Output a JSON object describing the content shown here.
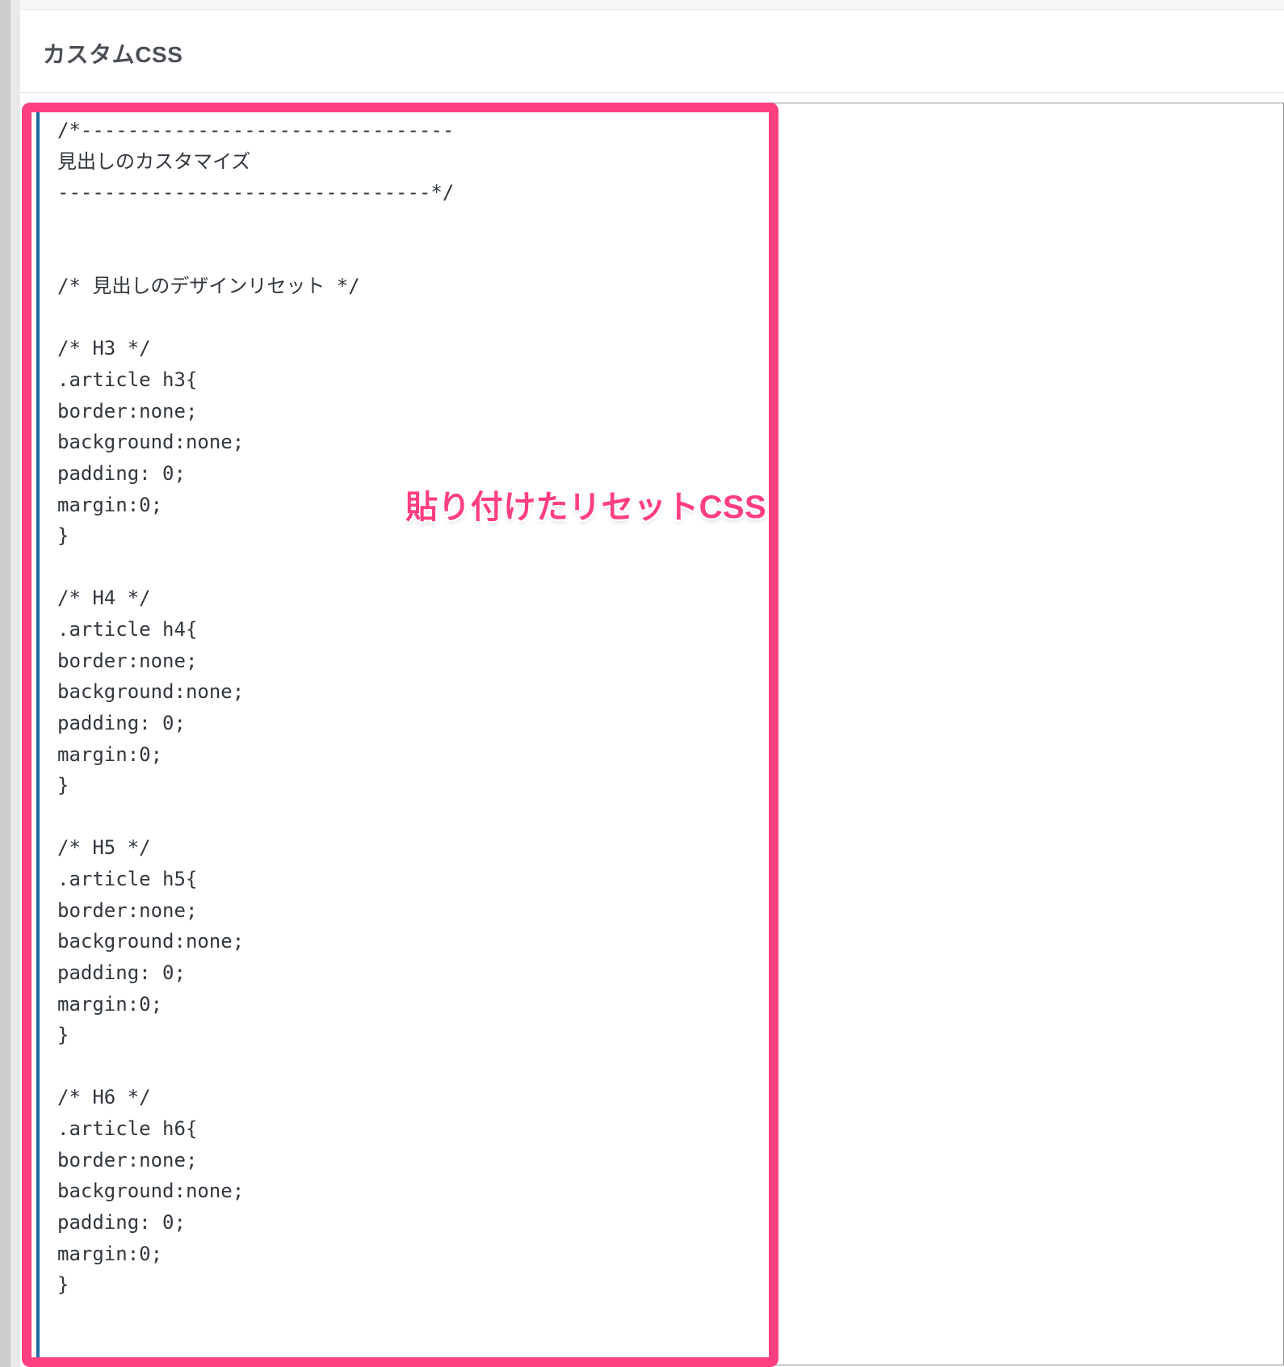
{
  "header": {
    "title": "カスタムCSS"
  },
  "editor": {
    "css": "/*--------------------------------\n見出しのカスタマイズ\n--------------------------------*/\n\n\n/* 見出しのデザインリセット */\n\n/* H3 */\n.article h3{\nborder:none;\nbackground:none;\npadding: 0;\nmargin:0;\n}\n\n/* H4 */\n.article h4{\nborder:none;\nbackground:none;\npadding: 0;\nmargin:0;\n}\n\n/* H5 */\n.article h5{\nborder:none;\nbackground:none;\npadding: 0;\nmargin:0;\n}\n\n/* H6 */\n.article h6{\nborder:none;\nbackground:none;\npadding: 0;\nmargin:0;\n}"
  },
  "annotation": {
    "label": "貼り付けたリセットCSS"
  },
  "colors": {
    "accent_pink": "#ff3f80",
    "editor_border_accent": "#1b6aa5"
  }
}
